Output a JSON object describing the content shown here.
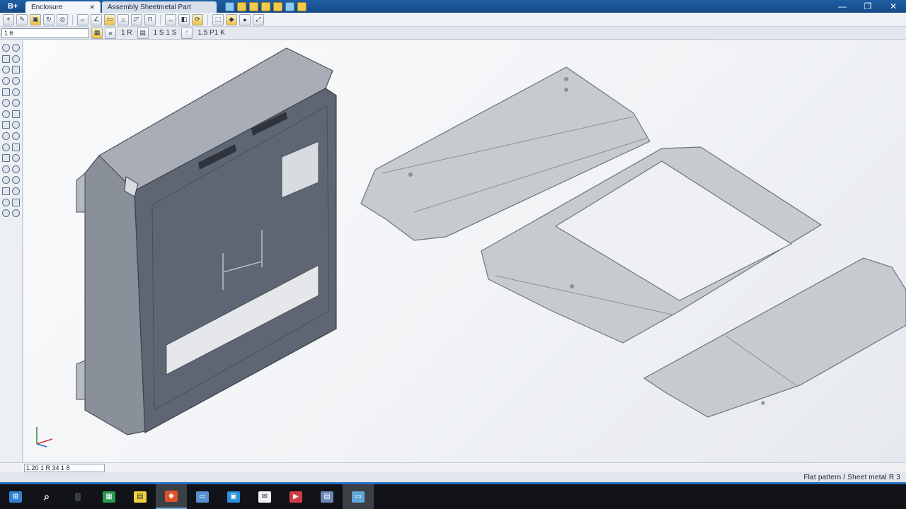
{
  "titlebar": {
    "logo": "B+",
    "doc_tab_1": "Enclosure",
    "doc_tab_2": "Assembly Sheetmetal Part",
    "window_controls": [
      "—",
      "❐",
      "✕"
    ]
  },
  "toolbar2": {
    "field_value": "1 ft",
    "label_a": "1 R",
    "label_b": "1 S 1 S",
    "label_c": "1.5 P1 K"
  },
  "statusbar": {
    "left": "1.20 1 R 34 1 8",
    "right": "Flat pattern / Sheet metal  R 3"
  },
  "colors": {
    "titlebar": "#1f5fa4",
    "part_dark": "#5f6673",
    "flat_pattern": "#c7cacf",
    "taskbar": "#111318"
  },
  "taskbar": {
    "icons": [
      "windows-start-icon",
      "search-icon",
      "task-view-icon",
      "spreadsheet-app-icon",
      "notes-app-icon",
      "cad-app-icon",
      "file-explorer-icon",
      "store-app-icon",
      "mail-app-icon",
      "presentation-app-icon",
      "documents-app-icon",
      "monitor-app-icon"
    ]
  }
}
